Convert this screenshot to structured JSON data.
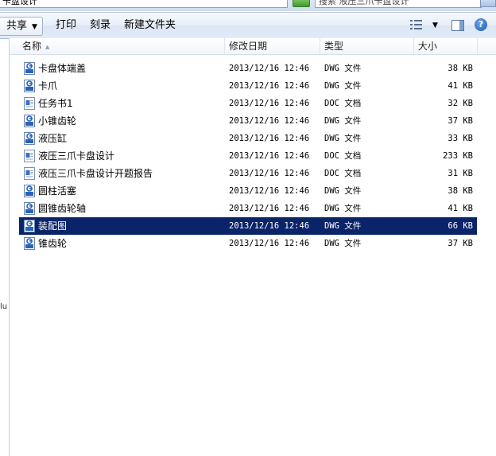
{
  "address": {
    "path": "卡盘设计",
    "search_text": "搜索 液压三爪卡盘设计"
  },
  "toolbar": {
    "share_label": "共享",
    "print_label": "打印",
    "burn_label": "刻录",
    "new_folder_label": "新建文件夹"
  },
  "columns": {
    "name": "名称",
    "date": "修改日期",
    "type": "类型",
    "size": "大小"
  },
  "stray_text": "lu",
  "files": [
    {
      "name": "卡盘体端盖",
      "date": "2013/12/16 12:46",
      "type": "DWG 文件",
      "size": "38 KB",
      "icon": "dwg-file-icon"
    },
    {
      "name": "卡爪",
      "date": "2013/12/16 12:46",
      "type": "DWG 文件",
      "size": "41 KB",
      "icon": "dwg-file-icon"
    },
    {
      "name": "任务书1",
      "date": "2013/12/16 12:46",
      "type": "DOC 文档",
      "size": "32 KB",
      "icon": "doc-file-icon"
    },
    {
      "name": "小锥齿轮",
      "date": "2013/12/16 12:46",
      "type": "DWG 文件",
      "size": "37 KB",
      "icon": "dwg-file-icon"
    },
    {
      "name": "液压缸",
      "date": "2013/12/16 12:46",
      "type": "DWG 文件",
      "size": "33 KB",
      "icon": "dwg-file-icon"
    },
    {
      "name": "液压三爪卡盘设计",
      "date": "2013/12/16 12:46",
      "type": "DOC 文档",
      "size": "233 KB",
      "icon": "doc-file-icon"
    },
    {
      "name": "液压三爪卡盘设计开题报告",
      "date": "2013/12/16 12:46",
      "type": "DOC 文档",
      "size": "31 KB",
      "icon": "doc-file-icon"
    },
    {
      "name": "圆柱活塞",
      "date": "2013/12/16 12:46",
      "type": "DWG 文件",
      "size": "38 KB",
      "icon": "dwg-file-icon"
    },
    {
      "name": "圆锥齿轮轴",
      "date": "2013/12/16 12:46",
      "type": "DWG 文件",
      "size": "41 KB",
      "icon": "dwg-file-icon"
    },
    {
      "name": "装配图",
      "date": "2013/12/16 12:46",
      "type": "DWG 文件",
      "size": "66 KB",
      "icon": "dwg-file-icon",
      "selected": true
    },
    {
      "name": "锥齿轮",
      "date": "2013/12/16 12:46",
      "type": "DWG 文件",
      "size": "37 KB",
      "icon": "dwg-file-icon"
    }
  ],
  "colors": {
    "selection": "#0a246a",
    "toolbar": "#dbe6f4"
  }
}
